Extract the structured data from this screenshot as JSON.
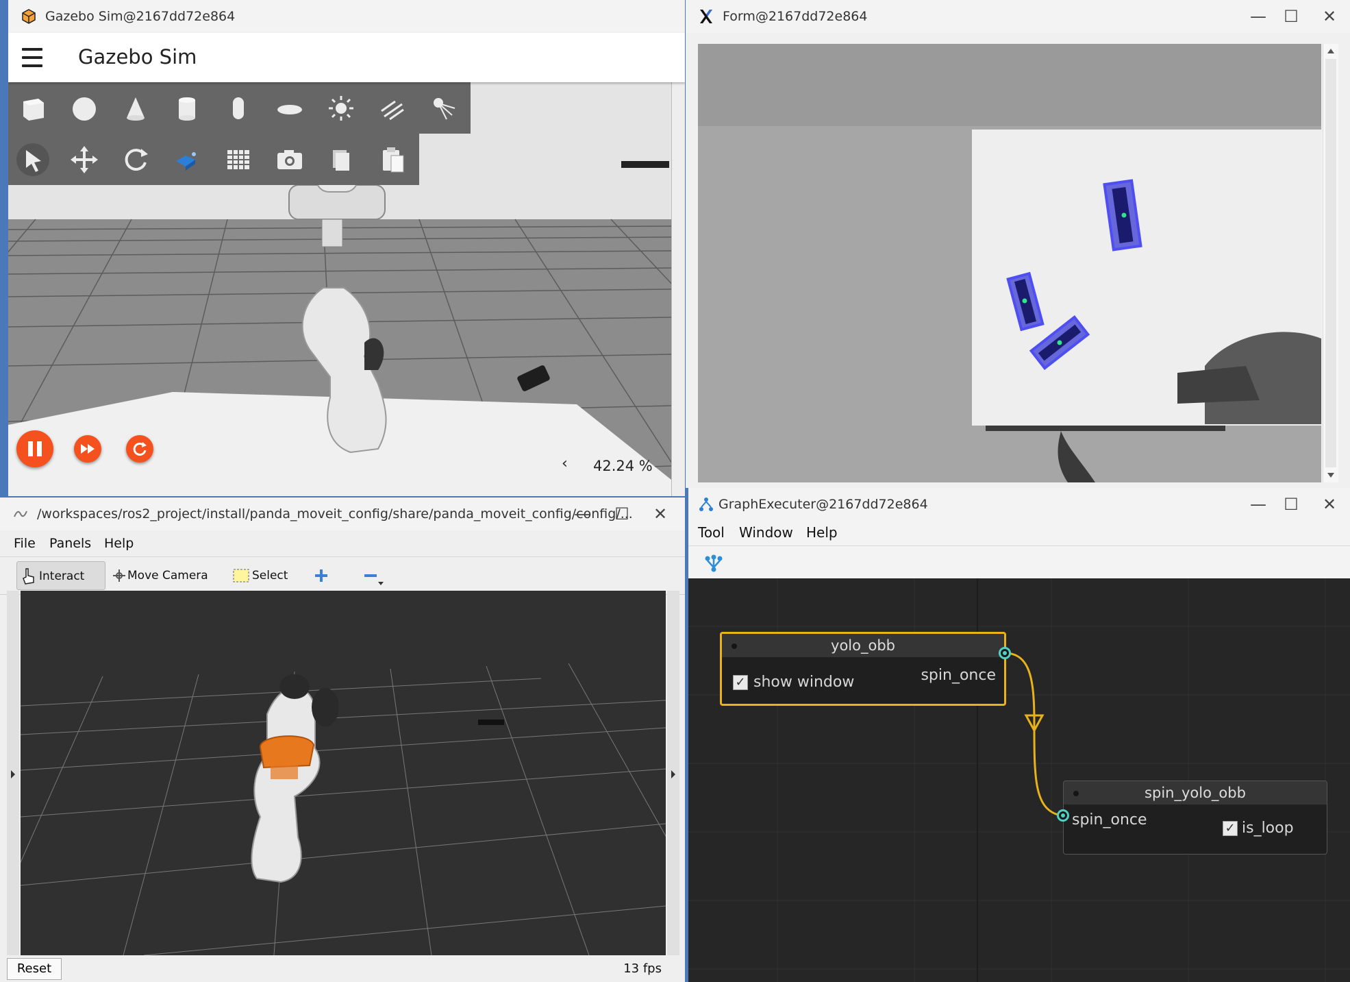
{
  "gazebo": {
    "window_title": "Gazebo Sim@2167dd72e864",
    "app_name": "Gazebo Sim",
    "shape_tools": [
      "box-icon",
      "sphere-icon",
      "cone-icon",
      "cylinder-icon",
      "capsule-icon",
      "ellipsoid-icon",
      "point-light-icon",
      "directional-light-icon",
      "spot-light-icon"
    ],
    "transform_tools": [
      "select-icon",
      "translate-icon",
      "rotate-icon",
      "snap-icon",
      "grid-icon",
      "screenshot-icon",
      "copy-icon",
      "paste-icon"
    ],
    "zoom_chevron": "‹",
    "rtf": "42.24 %"
  },
  "form": {
    "window_title": "Form@2167dd72e864",
    "detections": 3
  },
  "rviz": {
    "window_title": "/workspaces/ros2_project/install/panda_moveit_config/share/panda_moveit_config/config/...",
    "menu": [
      "File",
      "Panels",
      "Help"
    ],
    "tools": {
      "interact": "Interact",
      "move_camera": "Move Camera",
      "select": "Select"
    },
    "reset": "Reset",
    "fps": "13 fps"
  },
  "graph": {
    "window_title": "GraphExecuter@2167dd72e864",
    "menu": [
      "Tool",
      "Window",
      "Help"
    ],
    "node1": {
      "title": "yolo_obb",
      "checkbox_label": "show window",
      "checkbox_mark": "✓",
      "output": "spin_once"
    },
    "node2": {
      "title": "spin_yolo_obb",
      "input": "spin_once",
      "checkbox_label": "is_loop",
      "checkbox_mark": "✓"
    },
    "colors": {
      "accent": "#e9b21a",
      "port": "#4fd2c4"
    }
  },
  "window_controls": {
    "minimize": "—",
    "maximize": "☐",
    "close": "✕"
  }
}
